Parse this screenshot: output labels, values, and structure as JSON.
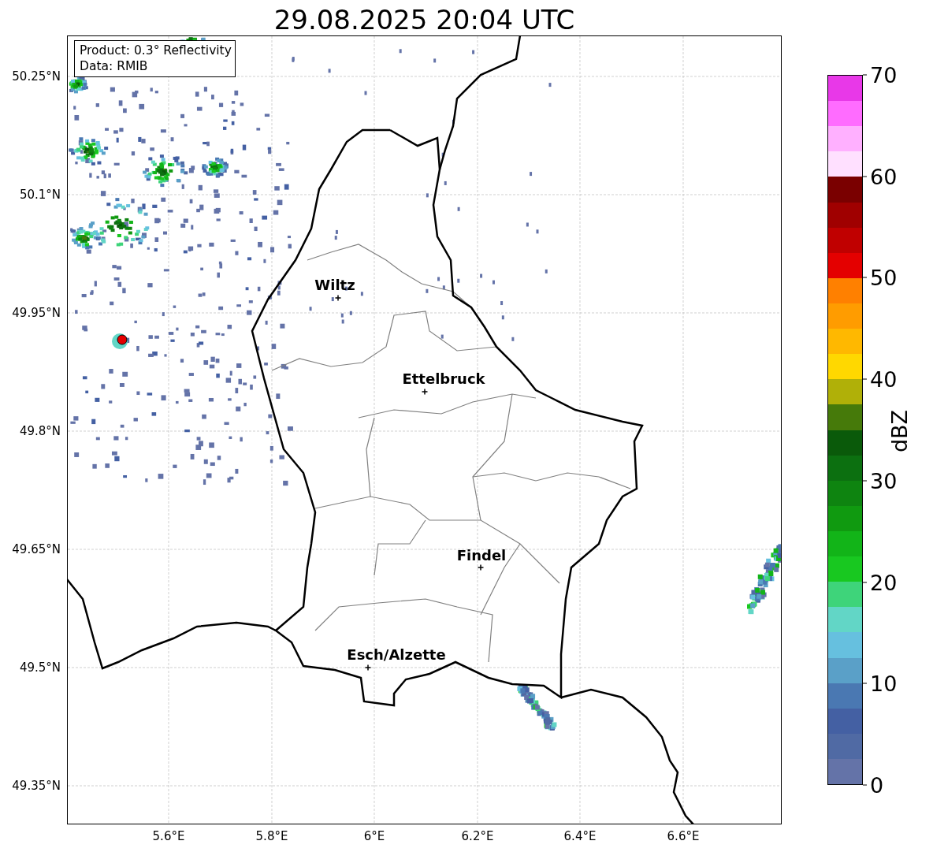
{
  "title": "29.08.2025 20:04 UTC",
  "info_box": [
    "Product: 0.3° Reflectivity",
    "Data: RMIB"
  ],
  "lat_labels": [
    "50.25°N",
    "50.1°N",
    "49.95°N",
    "49.8°N",
    "49.65°N",
    "49.5°N",
    "49.35°N"
  ],
  "lon_labels": [
    "5.6°E",
    "5.8°E",
    "6°E",
    "6.2°E",
    "6.4°E",
    "6.6°E"
  ],
  "cities": [
    {
      "name": "Wiltz"
    },
    {
      "name": "Ettelbruck"
    },
    {
      "name": "Findel"
    },
    {
      "name": "Esch/Alzette"
    }
  ],
  "colorbar": {
    "label": "dBZ",
    "ticks": [
      "70",
      "60",
      "50",
      "40",
      "30",
      "20",
      "10",
      "0"
    ],
    "bands": [
      {
        "color": "#e838e8"
      },
      {
        "color": "#ff6cff"
      },
      {
        "color": "#ffb0ff"
      },
      {
        "color": "#ffe0ff"
      },
      {
        "color": "#7a0000"
      },
      {
        "color": "#a00000"
      },
      {
        "color": "#c00000"
      },
      {
        "color": "#e40000"
      },
      {
        "color": "#ff8000"
      },
      {
        "color": "#ff9c00"
      },
      {
        "color": "#ffb800"
      },
      {
        "color": "#ffd800"
      },
      {
        "color": "#b0b008"
      },
      {
        "color": "#467a0a"
      },
      {
        "color": "#0a5a0a"
      },
      {
        "color": "#0c7010"
      },
      {
        "color": "#0e8410"
      },
      {
        "color": "#109a10"
      },
      {
        "color": "#12b418"
      },
      {
        "color": "#18c820"
      },
      {
        "color": "#3ed47a"
      },
      {
        "color": "#62d6c6"
      },
      {
        "color": "#66c0df"
      },
      {
        "color": "#5aa0c8"
      },
      {
        "color": "#4a78b2"
      },
      {
        "color": "#4460a3"
      },
      {
        "color": "#506aa4"
      },
      {
        "color": "#6473a8"
      }
    ]
  }
}
